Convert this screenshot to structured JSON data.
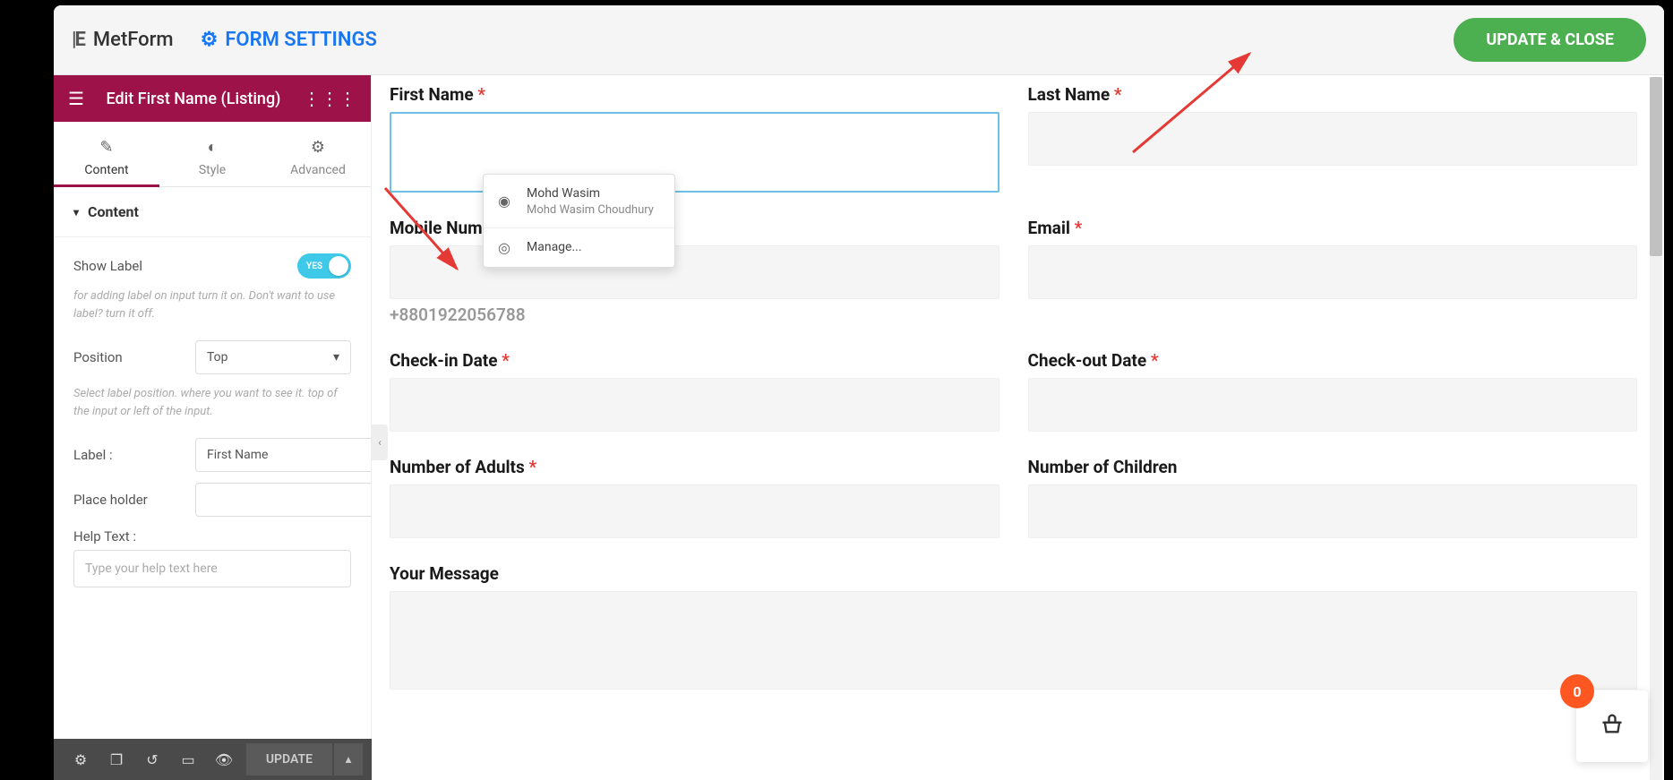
{
  "topbar": {
    "brand": "MetForm",
    "form_settings": "FORM SETTINGS",
    "update_close": "UPDATE & CLOSE"
  },
  "sidebar": {
    "title": "Edit First Name (Listing)",
    "tabs": {
      "content": "Content",
      "style": "Style",
      "advanced": "Advanced"
    },
    "section": "Content",
    "show_label": "Show Label",
    "toggle_value": "YES",
    "show_label_hint": "for adding label on input turn it on. Don't want to use label? turn it off.",
    "position_label": "Position",
    "position_value": "Top",
    "position_hint": "Select label position. where you want to see it. top of the input or left of the input.",
    "label_label": "Label :",
    "label_value": "First Name",
    "placeholder_label": "Place holder",
    "placeholder_value": "",
    "helptext_label": "Help Text :",
    "helptext_placeholder": "Type your help text here"
  },
  "footer": {
    "update": "UPDATE"
  },
  "form": {
    "fields": [
      {
        "label": "First Name",
        "required": true
      },
      {
        "label": "Last Name",
        "required": true
      },
      {
        "label": "Mobile Number",
        "required": true
      },
      {
        "label": "Email",
        "required": true
      },
      {
        "label": "Check-in Date",
        "required": true
      },
      {
        "label": "Check-out Date",
        "required": true
      },
      {
        "label": "Number of Adults",
        "required": true
      },
      {
        "label": "Number of Children",
        "required": false
      },
      {
        "label": "Your Message",
        "required": false
      }
    ],
    "phone_hint": "+8801922056788"
  },
  "autofill": {
    "name": "Mohd Wasim",
    "full": "Mohd Wasim Choudhury",
    "manage": "Manage..."
  },
  "cart": {
    "count": "0"
  }
}
